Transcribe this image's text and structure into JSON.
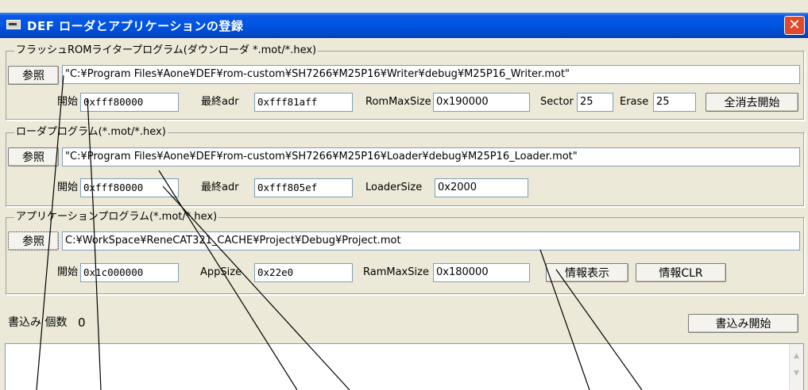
{
  "window": {
    "title": "DEF ローダとアプリケーションの登録",
    "close_label": "✕"
  },
  "writer": {
    "title": "フラッシュROMライタープログラム(ダウンローダ *.mot/*.hex)",
    "browse_label": "参照",
    "path": "\"C:¥Program Files¥Aone¥DEF¥rom-custom¥SH7266¥M25P16¥Writer¥debug¥M25P16_Writer.mot\"",
    "start_label": "開始",
    "start_value": "0xfff80000",
    "end_label": "最終adr",
    "end_value": "0xfff81aff",
    "rommax_label": "RomMaxSize",
    "rommax_value": "0x190000",
    "sector_label": "Sector",
    "sector_value": "25",
    "erase_label": "Erase",
    "erase_value": "25",
    "erase_all_label": "全消去開始"
  },
  "loader": {
    "title": "ローダプログラム(*.mot/*.hex)",
    "browse_label": "参照",
    "path": "\"C:¥Program Files¥Aone¥DEF¥rom-custom¥SH7266¥M25P16¥Loader¥debug¥M25P16_Loader.mot\"",
    "start_label": "開始",
    "start_value": "0xfff80000",
    "end_label": "最終adr",
    "end_value": "0xfff805ef",
    "size_label": "LoaderSize",
    "size_value": "0x2000"
  },
  "app": {
    "title": "アプリケーションプログラム(*.mot/*.hex)",
    "browse_label": "参照",
    "path": "C:¥WorkSpace¥ReneCAT321_CACHE¥Project¥Debug¥Project.mot",
    "start_label": "開始",
    "start_value": "0x1c000000",
    "size_label": "AppSize",
    "size_value": "0x22e0",
    "rammax_label": "RamMaxSize",
    "rammax_value": "0x180000",
    "info_show_label": "情報表示",
    "info_clr_label": "情報CLR"
  },
  "write": {
    "count_label": "書込み 個数",
    "count_value": "0",
    "start_button": "書込み開始"
  },
  "colors": {
    "titlebar": "#0054e3",
    "window_bg": "#ece9d8",
    "close": "#e04a2a"
  }
}
